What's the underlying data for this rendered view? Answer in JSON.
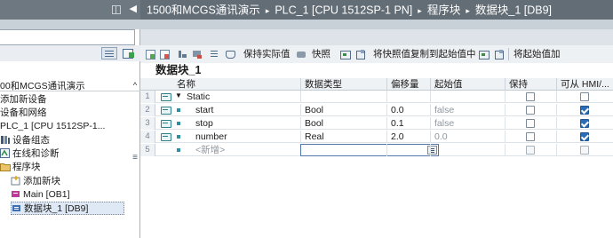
{
  "breadcrumb": {
    "items": [
      "1500和MCGS通讯演示",
      "PLC_1 [CPU 1512SP-1 PN]",
      "程序块",
      "数据块_1 [DB9]"
    ],
    "separator": "▸"
  },
  "toolbar": {
    "keep_actual_label": "保持实际值",
    "snapshot_label": "快照",
    "copy_snapshot_label": "将快照值复制到起始值中",
    "load_start_label": "将起始值加"
  },
  "block": {
    "title": "数据块_1"
  },
  "tree": {
    "items": [
      {
        "label": "00和MCGS通讯演示",
        "icon": "none"
      },
      {
        "label": "添加新设备",
        "icon": "none"
      },
      {
        "label": "设备和网络",
        "icon": "none"
      },
      {
        "label": "PLC_1 [CPU 1512SP-1...",
        "icon": "none"
      },
      {
        "label": "设备组态",
        "icon": "device-config-icon"
      },
      {
        "label": "在线和诊断",
        "icon": "online-diagnostics-icon"
      },
      {
        "label": "程序块",
        "icon": "folder-icon"
      },
      {
        "label": "添加新块",
        "icon": "add-block-icon"
      },
      {
        "label": "Main [OB1]",
        "icon": "ob-block-icon"
      },
      {
        "label": "数据块_1 [DB9]",
        "icon": "db-block-icon"
      }
    ]
  },
  "table": {
    "headers": [
      "名称",
      "数据类型",
      "偏移量",
      "起始值",
      "保持",
      "可从 HMI/..."
    ],
    "rows": [
      {
        "num": "1",
        "name": "Static",
        "type": "",
        "offset": "",
        "start": "",
        "retain": false,
        "hmi": false,
        "kind": "static"
      },
      {
        "num": "2",
        "name": "start",
        "type": "Bool",
        "offset": "0.0",
        "start": "false",
        "retain": false,
        "hmi": true,
        "kind": "var"
      },
      {
        "num": "3",
        "name": "stop",
        "type": "Bool",
        "offset": "0.1",
        "start": "false",
        "retain": false,
        "hmi": true,
        "kind": "var"
      },
      {
        "num": "4",
        "name": "number",
        "type": "Real",
        "offset": "2.0",
        "start": "0.0",
        "retain": false,
        "hmi": true,
        "kind": "var"
      },
      {
        "num": "5",
        "name": "<新增>",
        "type": "",
        "offset": "",
        "start": "",
        "retain": false,
        "hmi": false,
        "kind": "add"
      }
    ]
  },
  "colors": {
    "breadcrumb_bg": "#636d76",
    "checkbox_on": "#2a6db6",
    "io_icon": "#2f7f86",
    "selected_bg": "#dfe9f5"
  }
}
